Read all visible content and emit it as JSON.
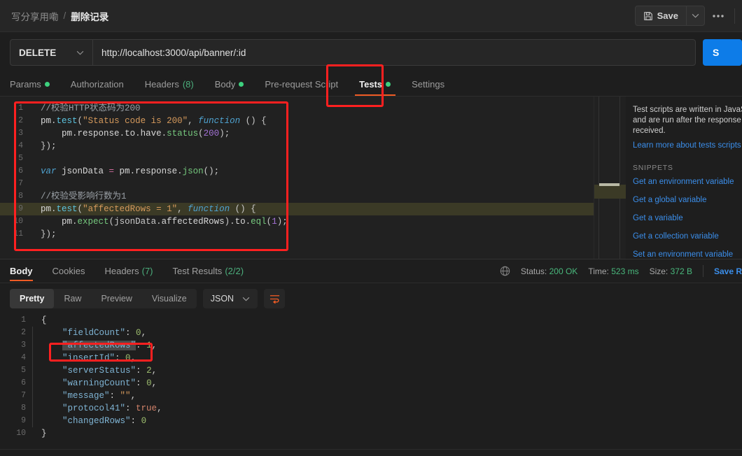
{
  "header": {
    "breadcrumb_parent": "写分享用嘞",
    "breadcrumb_separator": "/",
    "breadcrumb_current": "删除记录",
    "save_label": "Save",
    "save_caret": "⌄",
    "more_label": "000"
  },
  "request": {
    "method": "DELETE",
    "method_caret": "⌄",
    "url": "http://localhost:3000/api/banner/:id",
    "send_label": "S"
  },
  "request_tabs": [
    {
      "label": "Params",
      "dot": true,
      "count": "",
      "active": false
    },
    {
      "label": "Authorization",
      "dot": false,
      "count": "",
      "active": false
    },
    {
      "label": "Headers",
      "dot": false,
      "count": "(8)",
      "active": false
    },
    {
      "label": "Body",
      "dot": true,
      "count": "",
      "active": false
    },
    {
      "label": "Pre-request Script",
      "dot": false,
      "count": "",
      "active": false
    },
    {
      "label": "Tests",
      "dot": true,
      "count": "",
      "active": true
    },
    {
      "label": "Settings",
      "dot": false,
      "count": "",
      "active": false
    }
  ],
  "editor": {
    "lines": [
      {
        "n": "1",
        "highlight": false,
        "tokens": [
          {
            "t": "//校验HTTP状态码为200",
            "c": "c-cmt"
          }
        ]
      },
      {
        "n": "2",
        "highlight": false,
        "tokens": [
          {
            "t": "pm",
            "c": "c-pm"
          },
          {
            "t": ".",
            "c": "c-op"
          },
          {
            "t": "test",
            "c": "c-fn"
          },
          {
            "t": "(",
            "c": "c-op"
          },
          {
            "t": "\"Status code is 200\"",
            "c": "c-str"
          },
          {
            "t": ", ",
            "c": "c-op"
          },
          {
            "t": "function",
            "c": "c-kw"
          },
          {
            "t": " () {",
            "c": "c-op"
          }
        ]
      },
      {
        "n": "3",
        "highlight": false,
        "tokens": [
          {
            "t": "    ",
            "c": "indent-guide"
          },
          {
            "t": "pm",
            "c": "c-pm"
          },
          {
            "t": ".",
            "c": "c-op"
          },
          {
            "t": "response",
            "c": "c-pm"
          },
          {
            "t": ".",
            "c": "c-op"
          },
          {
            "t": "to",
            "c": "c-pm"
          },
          {
            "t": ".",
            "c": "c-op"
          },
          {
            "t": "have",
            "c": "c-pm"
          },
          {
            "t": ".",
            "c": "c-op"
          },
          {
            "t": "status",
            "c": "c-grn"
          },
          {
            "t": "(",
            "c": "c-op"
          },
          {
            "t": "200",
            "c": "c-num"
          },
          {
            "t": ");",
            "c": "c-op"
          }
        ]
      },
      {
        "n": "4",
        "highlight": false,
        "tokens": [
          {
            "t": "});",
            "c": "c-op"
          }
        ]
      },
      {
        "n": "5",
        "highlight": false,
        "tokens": [
          {
            "t": "",
            "c": "c-op"
          }
        ]
      },
      {
        "n": "6",
        "highlight": false,
        "tokens": [
          {
            "t": "var",
            "c": "c-kw"
          },
          {
            "t": " jsonData ",
            "c": "c-pm"
          },
          {
            "t": "=",
            "c": "c-pnk"
          },
          {
            "t": " pm",
            "c": "c-pm"
          },
          {
            "t": ".",
            "c": "c-op"
          },
          {
            "t": "response",
            "c": "c-pm"
          },
          {
            "t": ".",
            "c": "c-op"
          },
          {
            "t": "json",
            "c": "c-grn"
          },
          {
            "t": "();",
            "c": "c-op"
          }
        ]
      },
      {
        "n": "7",
        "highlight": false,
        "tokens": [
          {
            "t": "",
            "c": "c-op"
          }
        ]
      },
      {
        "n": "8",
        "highlight": false,
        "tokens": [
          {
            "t": "//校验受影响行数为1",
            "c": "c-cmt"
          }
        ]
      },
      {
        "n": "9",
        "highlight": true,
        "tokens": [
          {
            "t": "pm",
            "c": "c-pm"
          },
          {
            "t": ".",
            "c": "c-op"
          },
          {
            "t": "test",
            "c": "c-fn"
          },
          {
            "t": "(",
            "c": "c-op"
          },
          {
            "t": "\"affectedRows = 1\"",
            "c": "c-str"
          },
          {
            "t": ", ",
            "c": "c-op"
          },
          {
            "t": "function",
            "c": "c-kw"
          },
          {
            "t": " () {",
            "c": "c-op"
          }
        ]
      },
      {
        "n": "10",
        "highlight": false,
        "tokens": [
          {
            "t": "    ",
            "c": "indent-guide"
          },
          {
            "t": "pm",
            "c": "c-pm"
          },
          {
            "t": ".",
            "c": "c-op"
          },
          {
            "t": "expect",
            "c": "c-grn"
          },
          {
            "t": "(jsonData",
            "c": "c-op"
          },
          {
            "t": ".",
            "c": "c-op"
          },
          {
            "t": "affectedRows",
            "c": "c-pm"
          },
          {
            "t": ").",
            "c": "c-op"
          },
          {
            "t": "to",
            "c": "c-pm"
          },
          {
            "t": ".",
            "c": "c-op"
          },
          {
            "t": "eql",
            "c": "c-grn"
          },
          {
            "t": "(",
            "c": "c-op"
          },
          {
            "t": "1",
            "c": "c-num"
          },
          {
            "t": ");",
            "c": "c-op"
          }
        ]
      },
      {
        "n": "11",
        "highlight": false,
        "tokens": [
          {
            "t": "});",
            "c": "c-op"
          }
        ]
      }
    ]
  },
  "snippets": {
    "description": "Test scripts are written in JavaScript, and are run after the response is received.",
    "learn_more": "Learn more about tests scripts",
    "heading": "SNIPPETS",
    "items": [
      "Get an environment variable",
      "Get a global variable",
      "Get a variable",
      "Get a collection variable",
      "Set an environment variable"
    ]
  },
  "response_tabs": [
    {
      "label": "Body",
      "count": "",
      "active": true
    },
    {
      "label": "Cookies",
      "count": "",
      "active": false
    },
    {
      "label": "Headers",
      "count": "(7)",
      "active": false
    },
    {
      "label": "Test Results",
      "count": "(2/2)",
      "active": false
    }
  ],
  "response_status": {
    "status_label": "Status:",
    "status_value": "200 OK",
    "time_label": "Time:",
    "time_value": "523 ms",
    "size_label": "Size:",
    "size_value": "372 B",
    "save_response": "Save R"
  },
  "format_toolbar": {
    "views": [
      {
        "label": "Pretty",
        "active": true
      },
      {
        "label": "Raw",
        "active": false
      },
      {
        "label": "Preview",
        "active": false
      },
      {
        "label": "Visualize",
        "active": false
      }
    ],
    "language": "JSON",
    "language_caret": "⌄"
  },
  "response_body": {
    "lines": [
      {
        "n": "1",
        "bar": false,
        "tokens": [
          {
            "t": "{",
            "c": "j-punc"
          }
        ]
      },
      {
        "n": "2",
        "bar": true,
        "tokens": [
          {
            "t": "    ",
            "c": "j-punc"
          },
          {
            "t": "\"fieldCount\"",
            "c": "j-key"
          },
          {
            "t": ": ",
            "c": "j-punc"
          },
          {
            "t": "0",
            "c": "j-num"
          },
          {
            "t": ",",
            "c": "j-punc"
          }
        ]
      },
      {
        "n": "3",
        "bar": true,
        "tokens": [
          {
            "t": "    ",
            "c": "j-punc"
          },
          {
            "t": "\"affectedRows\"",
            "c": "j-key j-sel"
          },
          {
            "t": ": ",
            "c": "j-punc"
          },
          {
            "t": "1",
            "c": "j-num"
          },
          {
            "t": ",",
            "c": "j-punc"
          }
        ]
      },
      {
        "n": "4",
        "bar": true,
        "tokens": [
          {
            "t": "    ",
            "c": "j-punc"
          },
          {
            "t": "\"insertId\"",
            "c": "j-key"
          },
          {
            "t": ": ",
            "c": "j-punc"
          },
          {
            "t": "0",
            "c": "j-num"
          },
          {
            "t": ",",
            "c": "j-punc"
          }
        ]
      },
      {
        "n": "5",
        "bar": true,
        "tokens": [
          {
            "t": "    ",
            "c": "j-punc"
          },
          {
            "t": "\"serverStatus\"",
            "c": "j-key"
          },
          {
            "t": ": ",
            "c": "j-punc"
          },
          {
            "t": "2",
            "c": "j-num"
          },
          {
            "t": ",",
            "c": "j-punc"
          }
        ]
      },
      {
        "n": "6",
        "bar": true,
        "tokens": [
          {
            "t": "    ",
            "c": "j-punc"
          },
          {
            "t": "\"warningCount\"",
            "c": "j-key"
          },
          {
            "t": ": ",
            "c": "j-punc"
          },
          {
            "t": "0",
            "c": "j-num"
          },
          {
            "t": ",",
            "c": "j-punc"
          }
        ]
      },
      {
        "n": "7",
        "bar": true,
        "tokens": [
          {
            "t": "    ",
            "c": "j-punc"
          },
          {
            "t": "\"message\"",
            "c": "j-key"
          },
          {
            "t": ": ",
            "c": "j-punc"
          },
          {
            "t": "\"\"",
            "c": "j-str"
          },
          {
            "t": ",",
            "c": "j-punc"
          }
        ]
      },
      {
        "n": "8",
        "bar": true,
        "tokens": [
          {
            "t": "    ",
            "c": "j-punc"
          },
          {
            "t": "\"protocol41\"",
            "c": "j-key"
          },
          {
            "t": ": ",
            "c": "j-punc"
          },
          {
            "t": "true",
            "c": "j-bool"
          },
          {
            "t": ",",
            "c": "j-punc"
          }
        ]
      },
      {
        "n": "9",
        "bar": true,
        "tokens": [
          {
            "t": "    ",
            "c": "j-punc"
          },
          {
            "t": "\"changedRows\"",
            "c": "j-key"
          },
          {
            "t": ": ",
            "c": "j-punc"
          },
          {
            "t": "0",
            "c": "j-num"
          }
        ]
      },
      {
        "n": "10",
        "bar": false,
        "tokens": [
          {
            "t": "}",
            "c": "j-punc"
          }
        ]
      }
    ]
  },
  "annotations": {
    "accent_red": "#ff2020",
    "accent_orange": "#ef5b25",
    "accent_blue": "#0d7ce8",
    "dot_green": "#3dd17e"
  }
}
